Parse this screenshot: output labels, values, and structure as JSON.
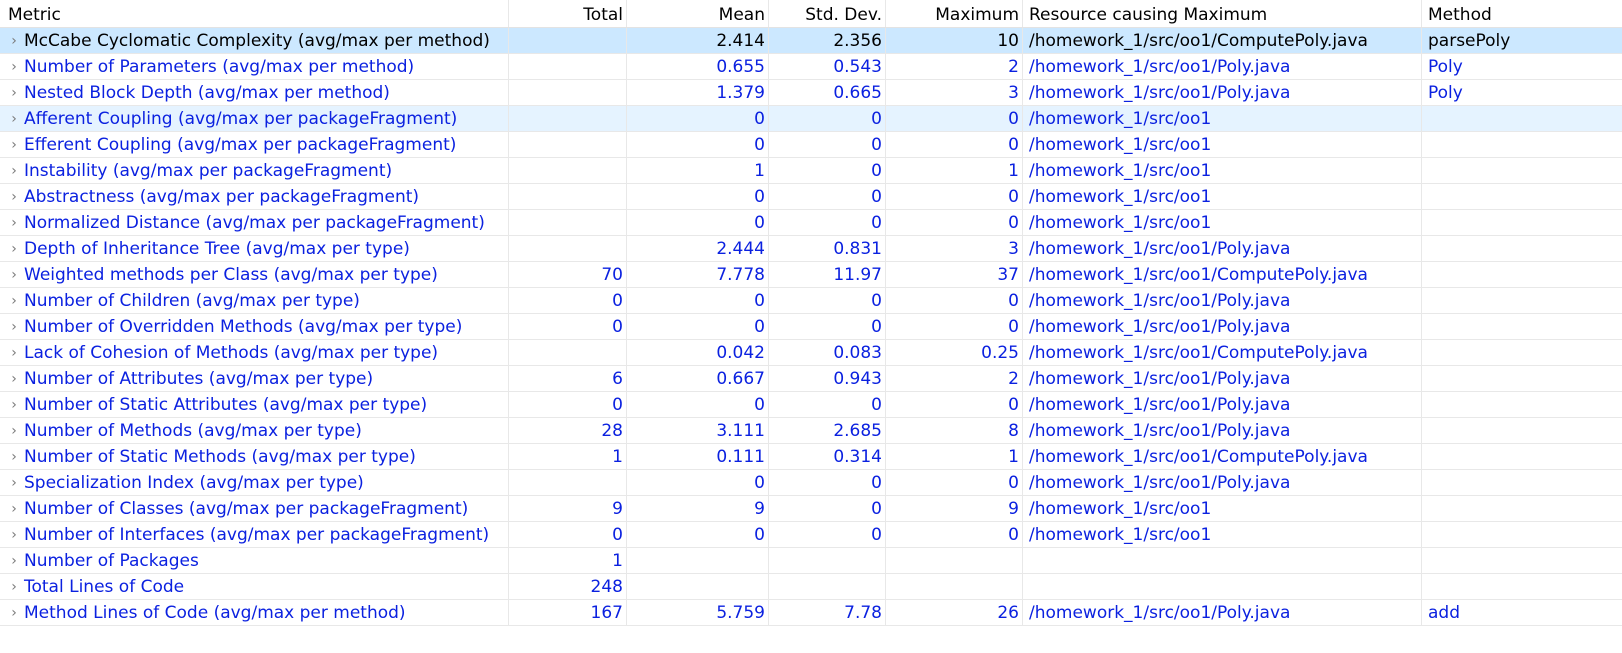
{
  "columns": {
    "metric": "Metric",
    "total": "Total",
    "mean": "Mean",
    "std": "Std. Dev.",
    "maximum": "Maximum",
    "resource": "Resource causing Maximum",
    "method": "Method"
  },
  "rows": [
    {
      "metric": "McCabe Cyclomatic Complexity (avg/max per method)",
      "total": "",
      "mean": "2.414",
      "std": "2.356",
      "maximum": "10",
      "resource": "/homework_1/src/oo1/ComputePoly.java",
      "method": "parsePoly"
    },
    {
      "metric": "Number of Parameters (avg/max per method)",
      "total": "",
      "mean": "0.655",
      "std": "0.543",
      "maximum": "2",
      "resource": "/homework_1/src/oo1/Poly.java",
      "method": "Poly"
    },
    {
      "metric": "Nested Block Depth (avg/max per method)",
      "total": "",
      "mean": "1.379",
      "std": "0.665",
      "maximum": "3",
      "resource": "/homework_1/src/oo1/Poly.java",
      "method": "Poly"
    },
    {
      "metric": "Afferent Coupling (avg/max per packageFragment)",
      "total": "",
      "mean": "0",
      "std": "0",
      "maximum": "0",
      "resource": "/homework_1/src/oo1",
      "method": ""
    },
    {
      "metric": "Efferent Coupling (avg/max per packageFragment)",
      "total": "",
      "mean": "0",
      "std": "0",
      "maximum": "0",
      "resource": "/homework_1/src/oo1",
      "method": ""
    },
    {
      "metric": "Instability (avg/max per packageFragment)",
      "total": "",
      "mean": "1",
      "std": "0",
      "maximum": "1",
      "resource": "/homework_1/src/oo1",
      "method": ""
    },
    {
      "metric": "Abstractness (avg/max per packageFragment)",
      "total": "",
      "mean": "0",
      "std": "0",
      "maximum": "0",
      "resource": "/homework_1/src/oo1",
      "method": ""
    },
    {
      "metric": "Normalized Distance (avg/max per packageFragment)",
      "total": "",
      "mean": "0",
      "std": "0",
      "maximum": "0",
      "resource": "/homework_1/src/oo1",
      "method": ""
    },
    {
      "metric": "Depth of Inheritance Tree (avg/max per type)",
      "total": "",
      "mean": "2.444",
      "std": "0.831",
      "maximum": "3",
      "resource": "/homework_1/src/oo1/Poly.java",
      "method": ""
    },
    {
      "metric": "Weighted methods per Class (avg/max per type)",
      "total": "70",
      "mean": "7.778",
      "std": "11.97",
      "maximum": "37",
      "resource": "/homework_1/src/oo1/ComputePoly.java",
      "method": ""
    },
    {
      "metric": "Number of Children (avg/max per type)",
      "total": "0",
      "mean": "0",
      "std": "0",
      "maximum": "0",
      "resource": "/homework_1/src/oo1/Poly.java",
      "method": ""
    },
    {
      "metric": "Number of Overridden Methods (avg/max per type)",
      "total": "0",
      "mean": "0",
      "std": "0",
      "maximum": "0",
      "resource": "/homework_1/src/oo1/Poly.java",
      "method": ""
    },
    {
      "metric": "Lack of Cohesion of Methods (avg/max per type)",
      "total": "",
      "mean": "0.042",
      "std": "0.083",
      "maximum": "0.25",
      "resource": "/homework_1/src/oo1/ComputePoly.java",
      "method": ""
    },
    {
      "metric": "Number of Attributes (avg/max per type)",
      "total": "6",
      "mean": "0.667",
      "std": "0.943",
      "maximum": "2",
      "resource": "/homework_1/src/oo1/Poly.java",
      "method": ""
    },
    {
      "metric": "Number of Static Attributes (avg/max per type)",
      "total": "0",
      "mean": "0",
      "std": "0",
      "maximum": "0",
      "resource": "/homework_1/src/oo1/Poly.java",
      "method": ""
    },
    {
      "metric": "Number of Methods (avg/max per type)",
      "total": "28",
      "mean": "3.111",
      "std": "2.685",
      "maximum": "8",
      "resource": "/homework_1/src/oo1/Poly.java",
      "method": ""
    },
    {
      "metric": "Number of Static Methods (avg/max per type)",
      "total": "1",
      "mean": "0.111",
      "std": "0.314",
      "maximum": "1",
      "resource": "/homework_1/src/oo1/ComputePoly.java",
      "method": ""
    },
    {
      "metric": "Specialization Index (avg/max per type)",
      "total": "",
      "mean": "0",
      "std": "0",
      "maximum": "0",
      "resource": "/homework_1/src/oo1/Poly.java",
      "method": ""
    },
    {
      "metric": "Number of Classes (avg/max per packageFragment)",
      "total": "9",
      "mean": "9",
      "std": "0",
      "maximum": "9",
      "resource": "/homework_1/src/oo1",
      "method": ""
    },
    {
      "metric": "Number of Interfaces (avg/max per packageFragment)",
      "total": "0",
      "mean": "0",
      "std": "0",
      "maximum": "0",
      "resource": "/homework_1/src/oo1",
      "method": ""
    },
    {
      "metric": "Number of Packages",
      "total": "1",
      "mean": "",
      "std": "",
      "maximum": "",
      "resource": "",
      "method": ""
    },
    {
      "metric": "Total Lines of Code",
      "total": "248",
      "mean": "",
      "std": "",
      "maximum": "",
      "resource": "",
      "method": ""
    },
    {
      "metric": "Method Lines of Code (avg/max per method)",
      "total": "167",
      "mean": "5.759",
      "std": "7.78",
      "maximum": "26",
      "resource": "/homework_1/src/oo1/Poly.java",
      "method": "add"
    }
  ],
  "selected_row_index": 0,
  "hover_row_index": 3,
  "icons": {
    "expand": "chevron-right-icon"
  },
  "colors": {
    "link_text": "#0b21e0",
    "selected_bg": "#cce8ff",
    "hover_bg": "#e5f3ff"
  }
}
